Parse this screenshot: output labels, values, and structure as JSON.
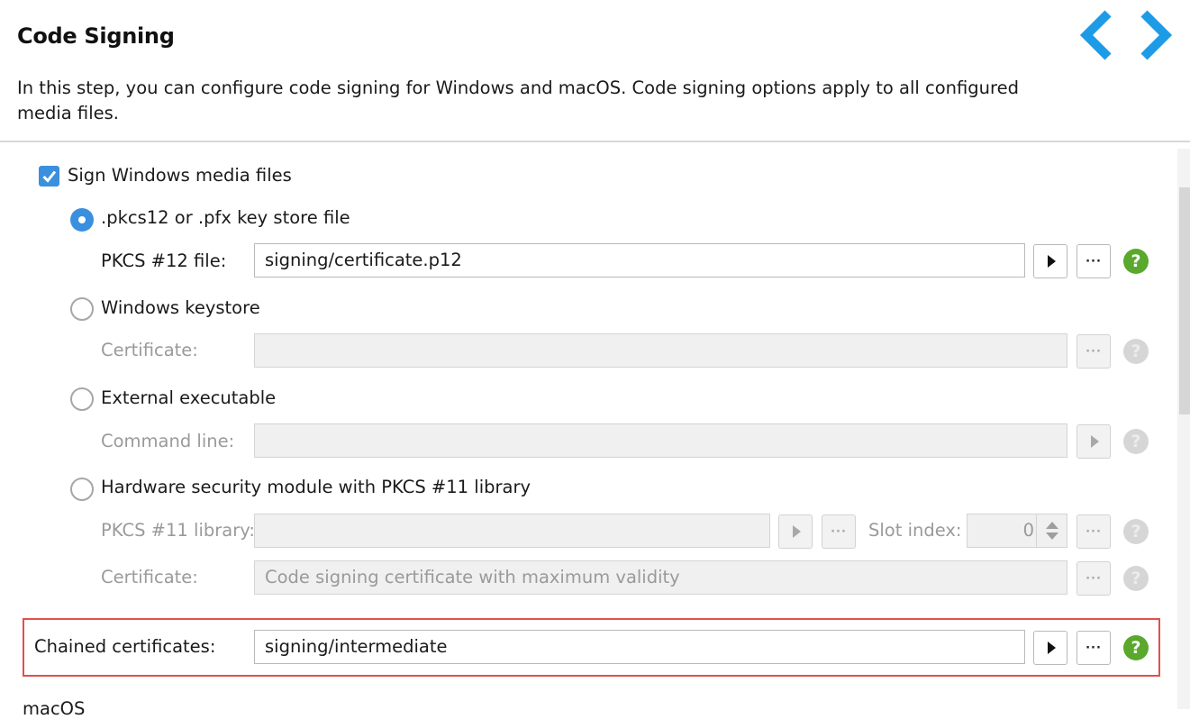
{
  "header": {
    "title": "Code Signing",
    "description": "In this step, you can configure code signing for Windows and macOS. Code signing options apply to all configured media files."
  },
  "windows": {
    "sign_label": "Sign Windows media files",
    "sign_checked": true,
    "options": {
      "pkcs12": {
        "label": ".pkcs12 or .pfx key store file",
        "selected": true
      },
      "keystore": {
        "label": "Windows keystore",
        "selected": false
      },
      "external": {
        "label": "External executable",
        "selected": false
      },
      "hsm": {
        "label": "Hardware security module with PKCS #11 library",
        "selected": false
      }
    },
    "pkcs12_file": {
      "label": "PKCS #12 file:",
      "value": "signing/certificate.p12"
    },
    "keystore_certificate": {
      "label": "Certificate:",
      "value": ""
    },
    "command_line": {
      "label": "Command line:",
      "value": ""
    },
    "pkcs11_library": {
      "label": "PKCS #11 library:",
      "value": ""
    },
    "slot_index": {
      "label": "Slot index:",
      "value": "0"
    },
    "hsm_certificate": {
      "label": "Certificate:",
      "value": "Code signing certificate with maximum validity"
    }
  },
  "chained": {
    "label": "Chained certificates:",
    "value": "signing/intermediate"
  },
  "macos": {
    "label": "macOS"
  },
  "buttons": {
    "browse_glyph": "···",
    "help_glyph": "?"
  },
  "colors": {
    "accent": "#3b8fdf",
    "help_green": "#5aa82c",
    "highlight": "#e0514d",
    "nav_blue": "#1e9be6"
  }
}
